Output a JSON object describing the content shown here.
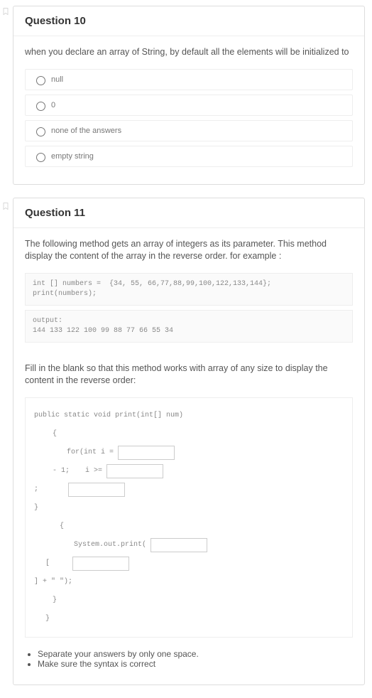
{
  "q10": {
    "title": "Question 10",
    "prompt": "when you declare an array of String, by default all the elements will be initialized to",
    "options": [
      "null",
      "0",
      "none of the answers",
      "empty string"
    ]
  },
  "q11": {
    "title": "Question 11",
    "prompt": "The following method gets an array of integers as its parameter. This method display the content of the array in the reverse order. for example :",
    "code1": "int [] numbers =  {34, 55, 66,77,88,99,100,122,133,144};\nprint(numbers);",
    "code2": "output:\n144 133 122 100 99 88 77 66 55 34",
    "prompt2": "Fill in the blank so that this method works with array of any size to display the content in the reverse order:",
    "sig": "public static void print(int[] num)",
    "brace_open": "{",
    "for_part1": "for(int i =",
    "for_part2a": "- 1;",
    "for_part2b": "i >=",
    "semicolon": ";",
    "brace_close": "}",
    "brace_open2": "{",
    "sout": "System.out.print(",
    "bracket_open": "[",
    "tail": "] + \" \");",
    "brace_close2": "}",
    "brace_close3": "}",
    "instr1": "Separate your answers by only one space.",
    "instr2": "Make sure the syntax is correct"
  }
}
